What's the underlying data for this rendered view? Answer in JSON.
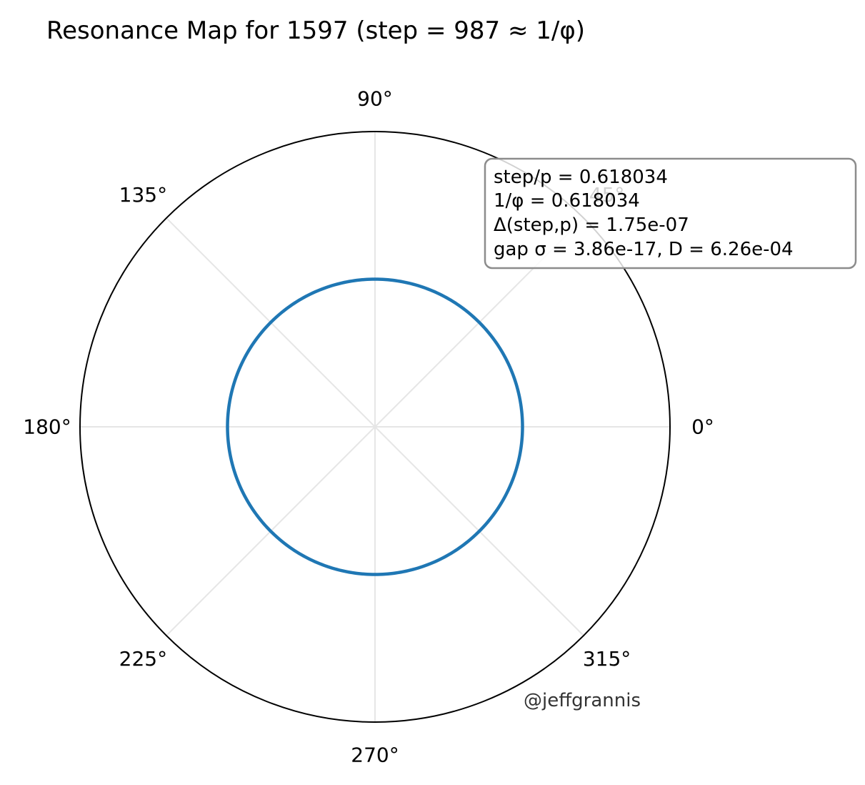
{
  "chart_data": {
    "type": "polar-line",
    "title": "Resonance Map for 1597  (step = 987 ≈ 1/φ)",
    "theta_tick_labels": [
      "0°",
      "45°",
      "90°",
      "135°",
      "180°",
      "225°",
      "270°",
      "315°"
    ],
    "theta_ticks_deg": [
      0,
      45,
      90,
      135,
      180,
      225,
      270,
      315
    ],
    "radial_tick_labels": [],
    "grid": true,
    "series": [
      {
        "r_constant": 0.5,
        "theta_range_deg": [
          0,
          360
        ],
        "color": "#1f77b4"
      }
    ],
    "rlim": [
      0,
      1
    ],
    "annotation_box": {
      "placement": "top-right",
      "lines": [
        "step/p = 0.618034",
        "1/φ = 0.618034",
        "Δ(step,p) = 1.75e-07",
        "gap σ = 3.86e-17, D = 6.26e-04"
      ]
    },
    "watermark": "@jeffgrannis"
  }
}
